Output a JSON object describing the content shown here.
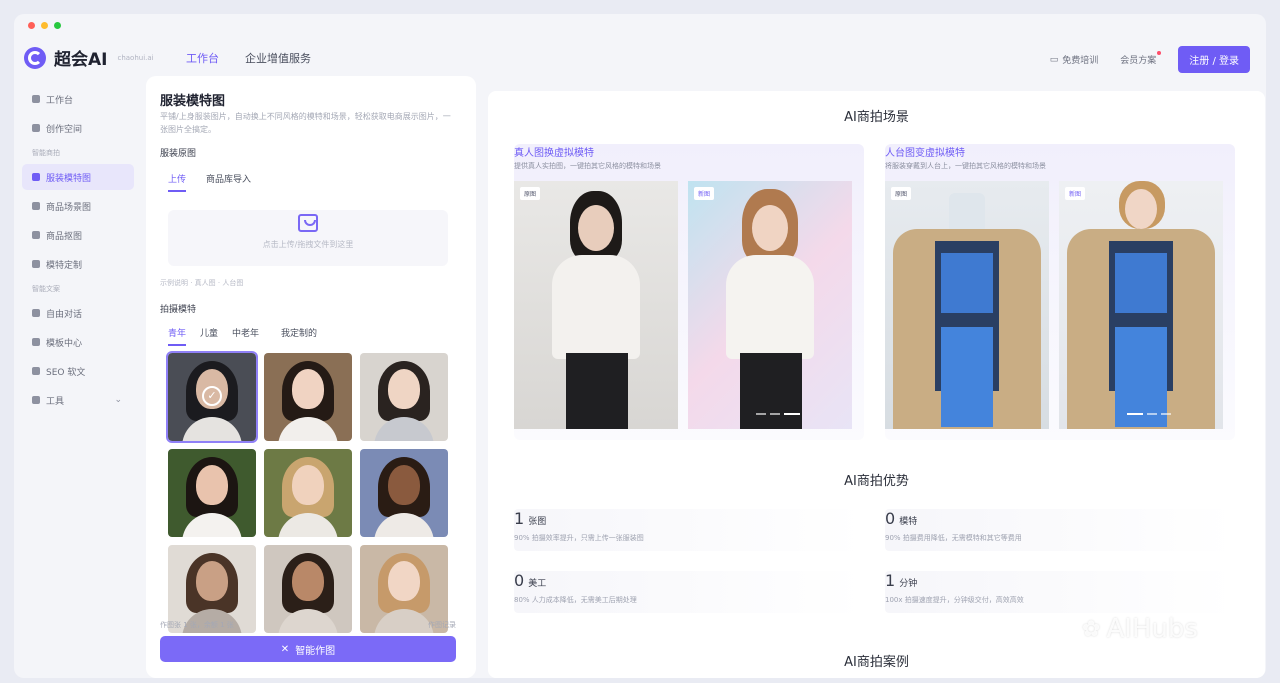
{
  "header": {
    "logo_text": "超会AI",
    "logo_sub": "chaohui.ai",
    "nav": [
      "工作台",
      "企业增值服务"
    ],
    "free_trial": "免费培训",
    "membership": "会员方案",
    "login": "注册 / 登录"
  },
  "sidebar": {
    "items_top": [
      "工作台",
      "创作空间"
    ],
    "group1": "智能商拍",
    "items_g1": [
      "服装模特图",
      "商品场景图",
      "商品抠图",
      "模特定制"
    ],
    "group2": "智能文案",
    "items_g2": [
      "自由对话",
      "模板中心",
      "SEO 软文",
      "工具"
    ]
  },
  "left_panel": {
    "title": "服装模特图",
    "desc": "平铺/上身服装图片，自动换上不同风格的模特和场景，轻松获取电商展示图片，一张图片全搞定。",
    "upload_label": "服装原图",
    "upload_tabs": [
      "上传",
      "商品库导入"
    ],
    "upload_text": "点击上传/拖拽文件到这里",
    "upload_hint": "示例说明 · 真人图 · 人台图",
    "model_label": "拍摄模特",
    "model_tabs": [
      "青年",
      "儿童",
      "中老年",
      "我定制的"
    ],
    "foot_left": "作图张 1 张，余额 1 张",
    "foot_right": "作图记录",
    "generate_button": "智能作图"
  },
  "right_panel": {
    "scene_title": "AI商拍场景",
    "scene1_title": "真人图换虚拟模特",
    "scene1_desc": "提供真人实拍图，一键拍其它风格的模特和场景",
    "scene2_title": "人台图变虚拟模特",
    "scene2_desc": "将服装穿戴到人台上，一键拍其它风格的模特和场景",
    "tag_original": "原图",
    "tag_new": "新图",
    "adv_title": "AI商拍优势",
    "advantages": [
      {
        "num": "1",
        "unit": "张图",
        "desc": "90% 拍摄效率提升，只需上传一张服装图"
      },
      {
        "num": "0",
        "unit": "模特",
        "desc": "90% 拍摄费用降低，无需模特和其它等费用"
      },
      {
        "num": "0",
        "unit": "美工",
        "desc": "80% 人力成本降低，无需美工后期处理"
      },
      {
        "num": "1",
        "unit": "分钟",
        "desc": "100x 拍摄速度提升，分钟级交付，高效高效"
      }
    ],
    "case_title": "AI商拍案例"
  },
  "watermark": "AIHubs",
  "colors": {
    "accent": "#6f5cf5",
    "accent_light": "#e8e6fb",
    "panel_bg": "#ffffff",
    "page_bg": "#f4f5f9"
  }
}
